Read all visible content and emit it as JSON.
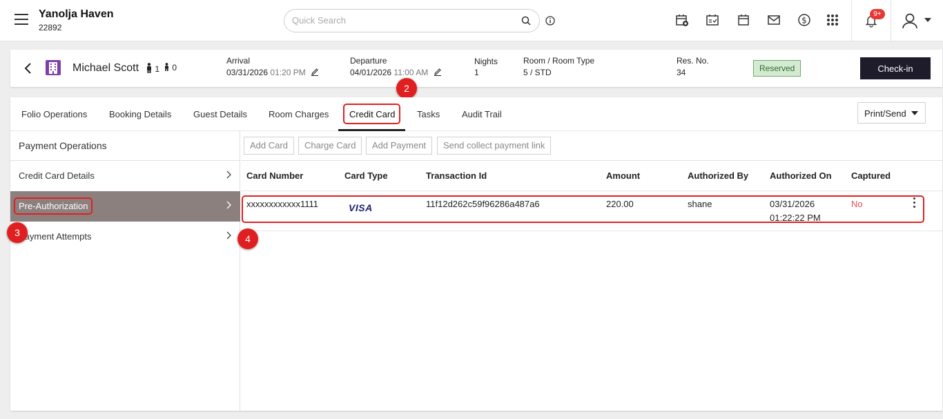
{
  "header": {
    "property_name": "Yanolja Haven",
    "property_id": "22892",
    "search_placeholder": "Quick Search",
    "notification_badge": "9+",
    "icons": [
      "menu-icon",
      "search-icon",
      "info-icon",
      "calendar-add-icon",
      "calendar-check-icon",
      "calendar-icon",
      "mail-icon",
      "dollar-icon",
      "apps-grid-icon",
      "bell-icon",
      "user-icon"
    ]
  },
  "reservation": {
    "guest_name": "Michael Scott",
    "adults": "1",
    "children": "0",
    "arrival_label": "Arrival",
    "arrival_date": "03/31/2026",
    "arrival_time": "01:20 PM",
    "departure_label": "Departure",
    "departure_date": "04/01/2026",
    "departure_time": "11:00 AM",
    "nights_label": "Nights",
    "nights_value": "1",
    "room_label": "Room / Room Type",
    "room_value": "5 / STD",
    "resno_label": "Res. No.",
    "resno_value": "34",
    "status": "Reserved",
    "checkin_label": "Check-in"
  },
  "tabs": [
    {
      "label": "Folio Operations"
    },
    {
      "label": "Booking Details"
    },
    {
      "label": "Guest Details"
    },
    {
      "label": "Room Charges"
    },
    {
      "label": "Credit Card"
    },
    {
      "label": "Tasks"
    },
    {
      "label": "Audit Trail"
    }
  ],
  "active_tab": "Credit Card",
  "print_send_label": "Print/Send",
  "left_nav": {
    "header": "Payment Operations",
    "items": [
      {
        "label": "Credit Card Details"
      },
      {
        "label": "Pre-Authorization"
      },
      {
        "label": "Payment Attempts"
      }
    ]
  },
  "actions": [
    "Add Card",
    "Charge Card",
    "Add Payment",
    "Send collect payment link"
  ],
  "table": {
    "columns": [
      "Card Number",
      "Card Type",
      "Transaction Id",
      "Amount",
      "Authorized By",
      "Authorized On",
      "Captured"
    ],
    "rows": [
      {
        "card_number": "xxxxxxxxxxxx1111",
        "card_type": "VISA",
        "transaction_id": "11f12d262c59f96286a487a6",
        "amount": "220.00",
        "authorized_by": "shane",
        "authorized_on_date": "03/31/2026",
        "authorized_on_time": "01:22:22 PM",
        "captured": "No"
      }
    ]
  },
  "markers": [
    "2",
    "3",
    "4"
  ],
  "colors": {
    "active_nav_bg": "#8c807e",
    "checkin_bg": "#1e1b2b",
    "status_bg": "#d4ebd2",
    "highlight": "#e02020",
    "captured_no": "#e05050"
  }
}
